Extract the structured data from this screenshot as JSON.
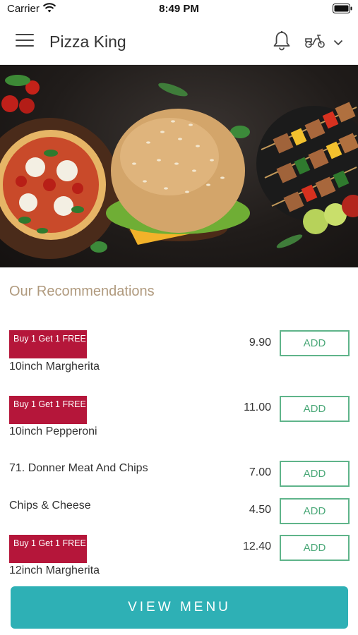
{
  "status_bar": {
    "carrier": "Carrier",
    "time": "8:49 PM"
  },
  "header": {
    "title": "Pizza King"
  },
  "section": {
    "title": "Our Recommendations"
  },
  "items": [
    {
      "badge": "Buy 1 Get 1 FREE",
      "name": "10inch Margherita",
      "price": "9.90",
      "action": "ADD"
    },
    {
      "badge": "Buy 1 Get 1 FREE",
      "name": "10inch Pepperoni",
      "price": "11.00",
      "action": "ADD"
    },
    {
      "badge": "",
      "name": "71. Donner Meat And Chips",
      "price": "7.00",
      "action": "ADD"
    },
    {
      "badge": "",
      "name": "Chips & Cheese",
      "price": "4.50",
      "action": "ADD"
    },
    {
      "badge": "Buy 1 Get 1 FREE",
      "name": "12inch Margherita",
      "price": "12.40",
      "action": "ADD"
    }
  ],
  "footer": {
    "view_menu_label": "VIEW MENU"
  },
  "colors": {
    "badge": "#b5163a",
    "add_border": "#5fb48a",
    "cta": "#2eb0b5",
    "section_title": "#b09a7e"
  },
  "icons": [
    "wifi-icon",
    "battery-icon",
    "hamburger-menu-icon",
    "bell-icon",
    "scooter-icon",
    "chevron-down-icon"
  ]
}
